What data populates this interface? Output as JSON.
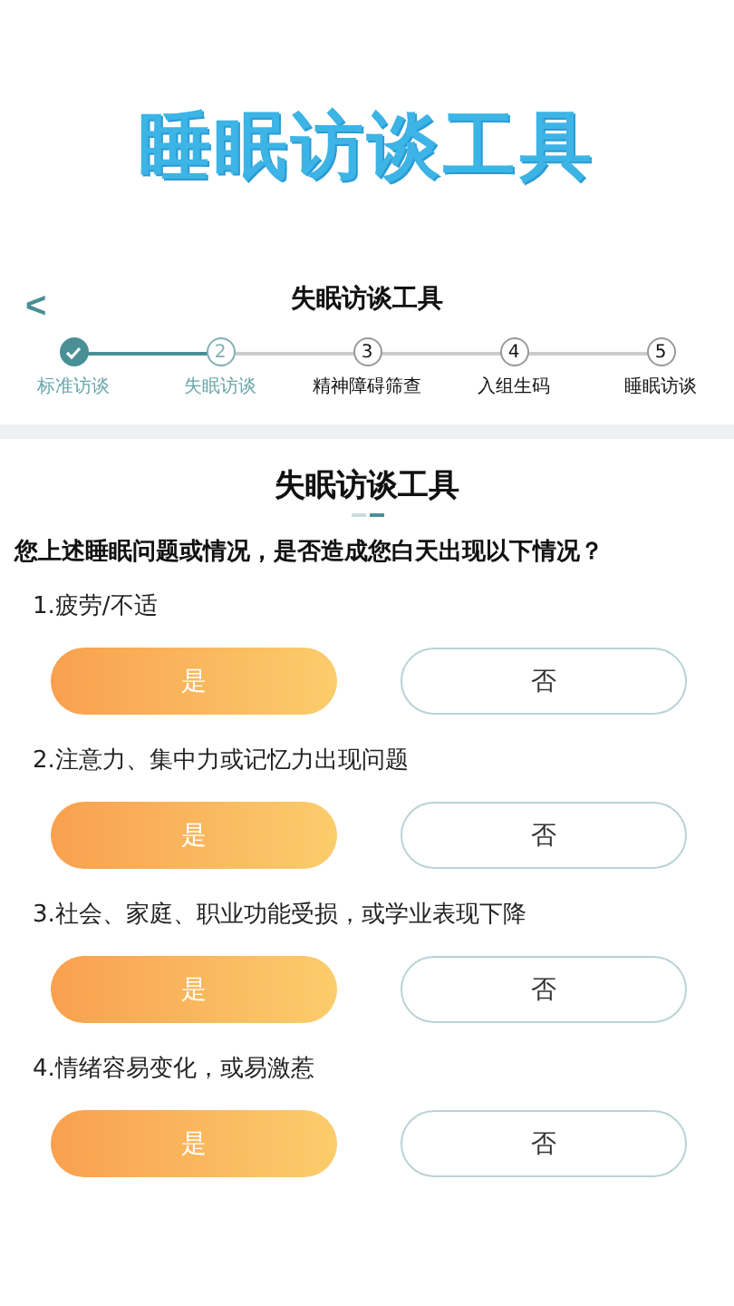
{
  "banner": {
    "title": "睡眠访谈工具"
  },
  "nav": {
    "back": "<",
    "title": "失眠访谈工具"
  },
  "steps": [
    {
      "label": "标准访谈",
      "done": true,
      "selected": false
    },
    {
      "number": "2",
      "label": "失眠访谈",
      "done": false,
      "selected": true
    },
    {
      "number": "3",
      "label": "精神障碍筛查",
      "done": false,
      "selected": false
    },
    {
      "number": "4",
      "label": "入组生码",
      "done": false,
      "selected": false
    },
    {
      "number": "5",
      "label": "睡眠访谈",
      "done": false,
      "selected": false
    }
  ],
  "card": {
    "title": "失眠访谈工具",
    "question": "您上述睡眠问题或情况，是否造成您白天出现以下情况？"
  },
  "items": [
    {
      "label": "1.疲劳/不适",
      "options": [
        {
          "label": "是",
          "selected": true
        },
        {
          "label": "否",
          "selected": false
        }
      ]
    },
    {
      "label": "2.注意力、集中力或记忆力出现问题",
      "options": [
        {
          "label": "是",
          "selected": true
        },
        {
          "label": "否",
          "selected": false
        }
      ]
    },
    {
      "label": "3.社会、家庭、职业功能受损，或学业表现下降",
      "options": [
        {
          "label": "是",
          "selected": true
        },
        {
          "label": "否",
          "selected": false
        }
      ]
    },
    {
      "label": "4.情绪容易变化，或易激惹",
      "options": [
        {
          "label": "是",
          "selected": true
        },
        {
          "label": "否",
          "selected": false
        }
      ]
    }
  ]
}
